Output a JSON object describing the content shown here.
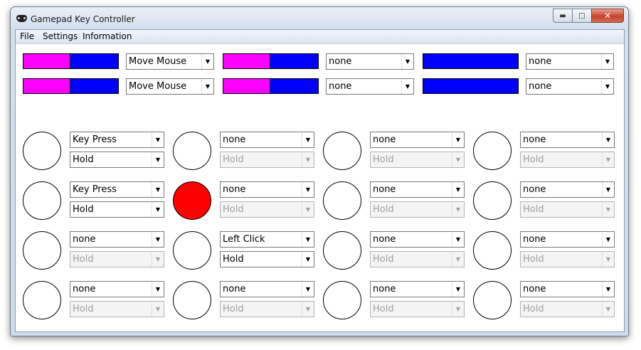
{
  "window": {
    "title": "Gamepad Key Controller"
  },
  "menu": [
    "File",
    "Settings",
    "Information"
  ],
  "colors": {
    "magenta": "#ff00ff",
    "blue": "#0000ff",
    "pressed": "#ff0000"
  },
  "analog_rows": [
    [
      {
        "bar": {
          "magenta_fraction": 0.49
        },
        "mode": "Move Mouse"
      },
      {
        "bar": {
          "magenta_fraction": 0.49
        },
        "mode": "none"
      },
      {
        "bar": {
          "magenta_fraction": 0.0
        },
        "mode": "none"
      }
    ],
    [
      {
        "bar": {
          "magenta_fraction": 0.49
        },
        "mode": "Move Mouse"
      },
      {
        "bar": {
          "magenta_fraction": 0.49
        },
        "mode": "none"
      },
      {
        "bar": {
          "magenta_fraction": 0.0
        },
        "mode": "none"
      }
    ]
  ],
  "button_rows": [
    [
      {
        "pressed": false,
        "action": "Key Press",
        "mode": "Hold",
        "mode_enabled": true
      },
      {
        "pressed": false,
        "action": "none",
        "mode": "Hold",
        "mode_enabled": false
      },
      {
        "pressed": false,
        "action": "none",
        "mode": "Hold",
        "mode_enabled": false
      },
      {
        "pressed": false,
        "action": "none",
        "mode": "Hold",
        "mode_enabled": false
      }
    ],
    [
      {
        "pressed": false,
        "action": "Key Press",
        "mode": "Hold",
        "mode_enabled": true
      },
      {
        "pressed": true,
        "action": "none",
        "mode": "Hold",
        "mode_enabled": false
      },
      {
        "pressed": false,
        "action": "none",
        "mode": "Hold",
        "mode_enabled": false
      },
      {
        "pressed": false,
        "action": "none",
        "mode": "Hold",
        "mode_enabled": false
      }
    ],
    [
      {
        "pressed": false,
        "action": "none",
        "mode": "Hold",
        "mode_enabled": false
      },
      {
        "pressed": false,
        "action": "Left Click",
        "mode": "Hold",
        "mode_enabled": true
      },
      {
        "pressed": false,
        "action": "none",
        "mode": "Hold",
        "mode_enabled": false
      },
      {
        "pressed": false,
        "action": "none",
        "mode": "Hold",
        "mode_enabled": false
      }
    ],
    [
      {
        "pressed": false,
        "action": "none",
        "mode": "Hold",
        "mode_enabled": false
      },
      {
        "pressed": false,
        "action": "none",
        "mode": "Hold",
        "mode_enabled": false
      },
      {
        "pressed": false,
        "action": "none",
        "mode": "Hold",
        "mode_enabled": false
      },
      {
        "pressed": false,
        "action": "none",
        "mode": "Hold",
        "mode_enabled": false
      }
    ]
  ]
}
